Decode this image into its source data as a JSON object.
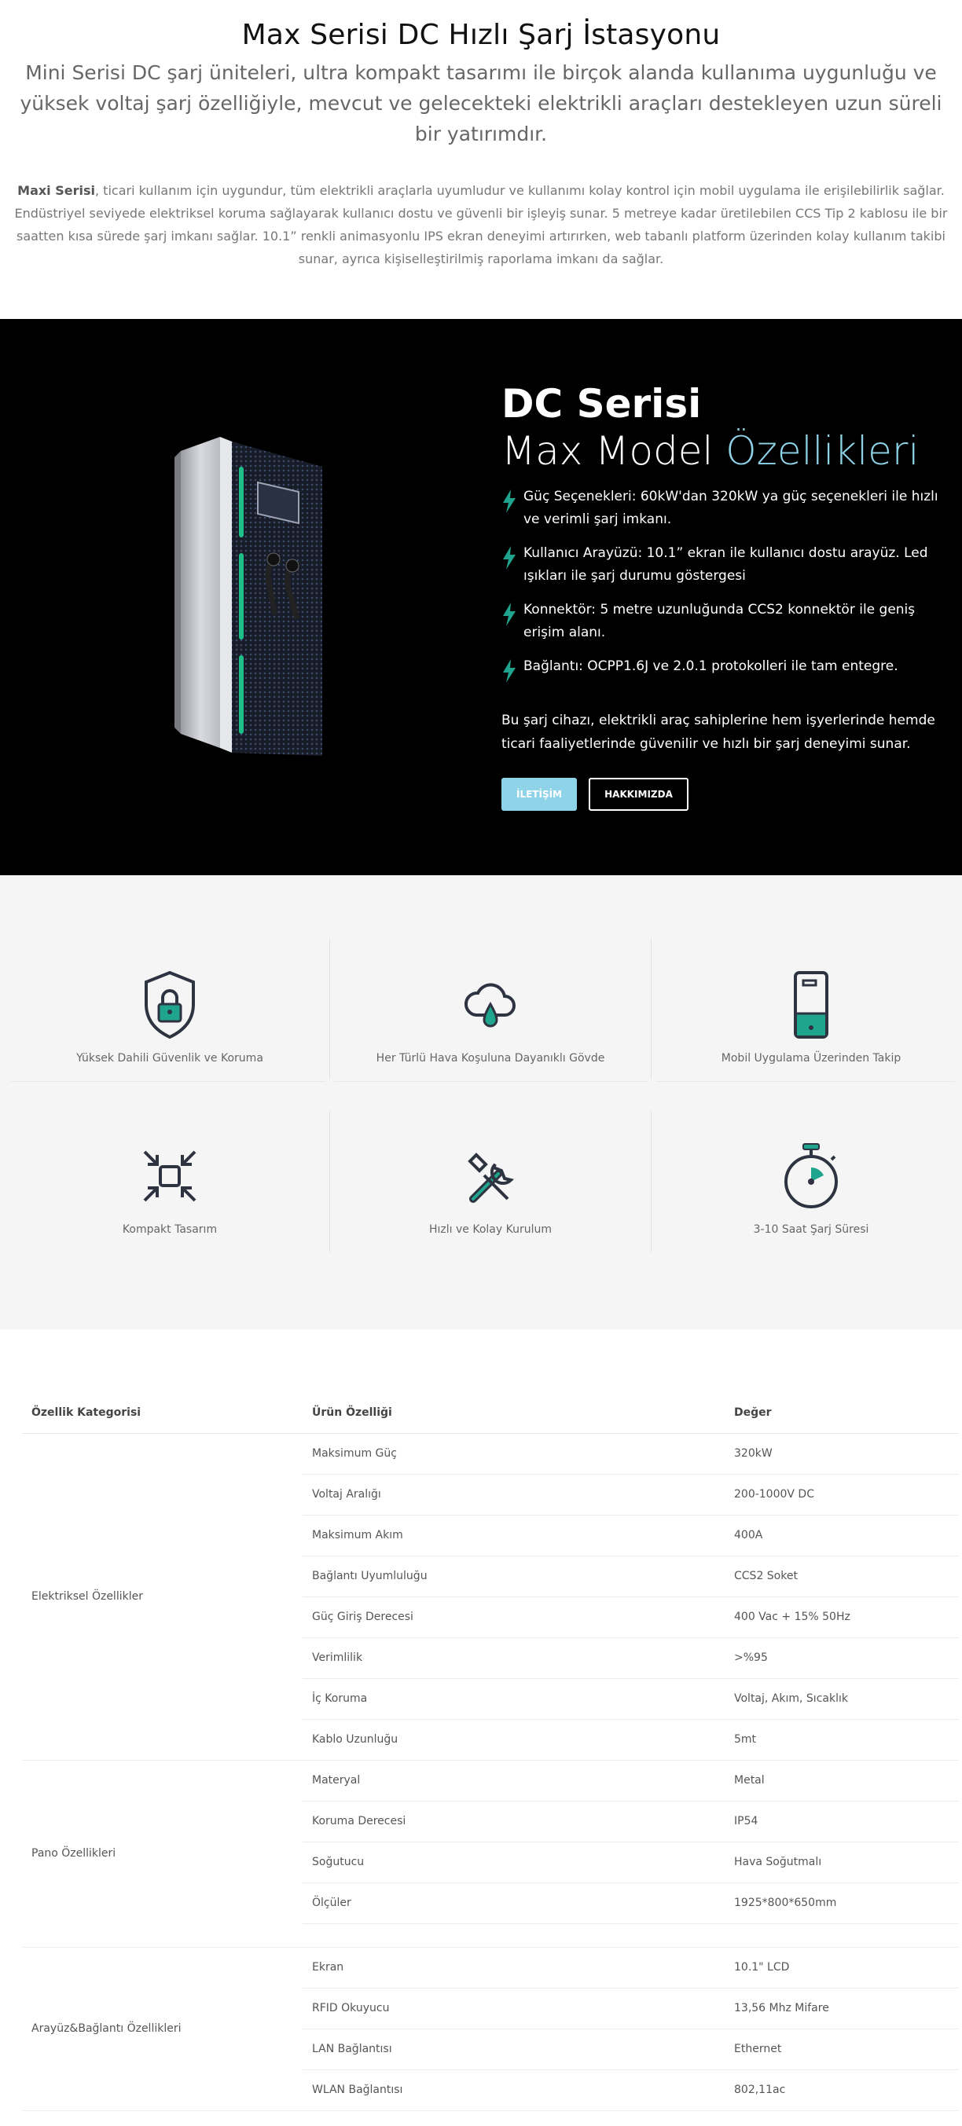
{
  "intro": {
    "title": "Max Serisi DC Hızlı Şarj İstasyonu",
    "subtitle": "Mini Serisi DC şarj üniteleri, ultra kompakt tasarımı ile birçok alanda kullanıma uygunluğu ve yüksek voltaj şarj özelliğiyle, mevcut ve gelecekteki elektrikli araçları destekleyen uzun süreli bir yatırımdır.",
    "desc_bold": "Maxi Serisi",
    "desc_rest": ", ticari kullanım için uygundur, tüm elektrikli araçlarla uyumludur ve kullanımı kolay kontrol için mobil uygulama ile erişilebilirlik sağlar. Endüstriyel seviyede elektriksel koruma sağlayarak kullanıcı dostu ve güvenli bir işleyiş sunar. 5 metreye kadar üretilebilen CCS Tip 2 kablosu ile bir saatten kısa sürede şarj imkanı sağlar. 10.1” renkli animasyonlu IPS ekran deneyimi artırırken, web tabanlı platform üzerinden kolay kullanım takibi sunar, ayrıca kişiselleştirilmiş raporlama imkanı da sağlar."
  },
  "hero": {
    "title_line1": "DC Serisi",
    "title_line2_plain": "Max Model ",
    "title_line2_accent": "Özellikleri",
    "bullets": [
      "Güç Seçenekleri: 60kW'dan 320kW ya güç seçenekleri ile hızlı ve verimli şarj imkanı.",
      "Kullanıcı Arayüzü: 10.1” ekran ile kullanıcı dostu arayüz. Led ışıkları ile şarj durumu göstergesi",
      "Konnektör: 5 metre uzunluğunda CCS2 konnektör ile geniş erişim alanı.",
      "Bağlantı: OCPP1.6J ve 2.0.1 protokolleri ile tam entegre."
    ],
    "note": "Bu şarj cihazı, elektrikli araç sahiplerine hem işyerlerinde hemde ticari faaliyetlerinde güvenilir ve hızlı bir şarj deneyimi sunar.",
    "btn_contact": "İLETİŞİM",
    "btn_about": "HAKKIMIZDA",
    "accent_color": "#8fd3e8",
    "bolt_color": "#1fa58e"
  },
  "features": [
    {
      "icon": "shield-lock-icon",
      "label": "Yüksek Dahili Güvenlik ve Koruma"
    },
    {
      "icon": "cloud-drop-icon",
      "label": "Her Türlü Hava Koşuluna Dayanıklı Gövde"
    },
    {
      "icon": "mobile-app-icon",
      "label": "Mobil Uygulama Üzerinden Takip"
    },
    {
      "icon": "compact-arrows-icon",
      "label": "Kompakt Tasarım"
    },
    {
      "icon": "tools-icon",
      "label": "Hızlı ve Kolay Kurulum"
    },
    {
      "icon": "stopwatch-icon",
      "label": "3-10 Saat Şarj Süresi"
    }
  ],
  "specs": {
    "headers": [
      "Özellik Kategorisi",
      "Ürün Özelliği",
      "Değer"
    ],
    "groups": [
      {
        "category": "Elektriksel Özellikler",
        "rows": [
          [
            "Maksimum Güç",
            "320kW"
          ],
          [
            "Voltaj Aralığı",
            "200-1000V DC"
          ],
          [
            "Maksimum Akım",
            "400A"
          ],
          [
            "Bağlantı Uyumluluğu",
            "CCS2 Soket"
          ],
          [
            "Güç Giriş Derecesi",
            "400 Vac + 15% 50Hz"
          ],
          [
            "Verimlilik",
            ">%95"
          ],
          [
            "İç Koruma",
            "Voltaj, Akım, Sıcaklık"
          ],
          [
            "Kablo Uzunluğu",
            "5mt"
          ]
        ]
      },
      {
        "category": "Pano Özellikleri",
        "rows": [
          [
            "Materyal",
            "Metal"
          ],
          [
            "Koruma Derecesi",
            "IP54"
          ],
          [
            "Soğutucu",
            "Hava Soğutmalı"
          ],
          [
            "Ölçüler",
            "1925*800*650mm"
          ]
        ]
      },
      {
        "category": "Arayüz&Bağlantı Özellikleri",
        "rows": [
          [
            "Ekran",
            "10.1\" LCD"
          ],
          [
            "RFID Okuyucu",
            "13,56 Mhz Mifare"
          ],
          [
            "LAN Bağlantısı",
            "Ethernet"
          ],
          [
            "WLAN Bağlantısı",
            "802,11ac"
          ]
        ]
      }
    ]
  }
}
